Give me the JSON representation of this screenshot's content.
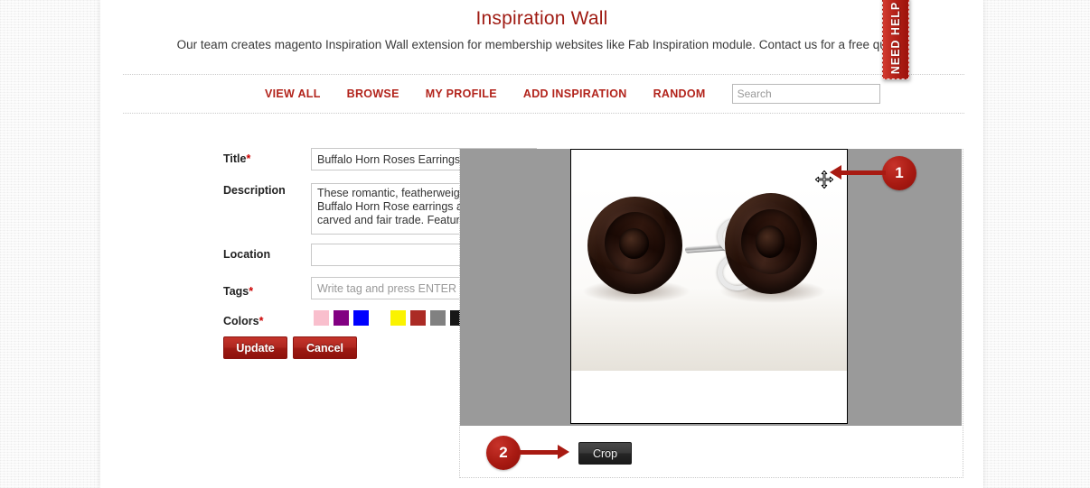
{
  "site": {
    "title": "Inspiration Wall",
    "tagline": "Our team creates magento Inspiration Wall extension for membership websites like Fab Inspiration module. Contact us for a free quote."
  },
  "nav": {
    "items": [
      {
        "label": "VIEW ALL"
      },
      {
        "label": "BROWSE"
      },
      {
        "label": "MY PROFILE"
      },
      {
        "label": "ADD INSPIRATION"
      },
      {
        "label": "RANDOM"
      }
    ],
    "search": {
      "value": "",
      "placeholder": "Search"
    }
  },
  "form": {
    "title": {
      "label": "Title",
      "required": "*",
      "value": "Buffalo Horn Roses Earrings",
      "placeholder": ""
    },
    "description": {
      "label": "Description",
      "required": "",
      "value": "These romantic, featherweight Black Buffalo Horn Rose earrings are hand-carved and fair trade. Featuring",
      "placeholder": ""
    },
    "location": {
      "label": "Location",
      "required": "",
      "value": "",
      "placeholder": ""
    },
    "tags": {
      "label": "Tags",
      "required": "*",
      "value": "",
      "placeholder": "Write tag and press ENTER"
    },
    "colors": {
      "label": "Colors",
      "required": "*",
      "swatches": [
        {
          "name": "pink",
          "hex": "#f9bfcd"
        },
        {
          "name": "purple",
          "hex": "#820082"
        },
        {
          "name": "blue",
          "hex": "#0000ff"
        },
        {
          "name": "yellow",
          "hex": "#fbf300"
        },
        {
          "name": "brick-red",
          "hex": "#ab2b25"
        },
        {
          "name": "gray",
          "hex": "#818181"
        },
        {
          "name": "black",
          "hex": "#171717"
        },
        {
          "name": "green",
          "hex": "#0a7f0a"
        }
      ]
    },
    "buttons": {
      "update": "Update",
      "cancel": "Cancel"
    }
  },
  "cropper": {
    "crop_button": "Crop",
    "markers": [
      {
        "number": "1",
        "direction": "left"
      },
      {
        "number": "2",
        "direction": "right"
      }
    ],
    "cursor_icon": "move-cursor-icon",
    "photo_alt": "black buffalo horn carved rose stud earrings"
  },
  "help_tab": {
    "label": "NEED HELP"
  },
  "theme": {
    "brand_red": "#b2231b",
    "title_red": "#9f1a12",
    "marker_red": "#a81a12"
  }
}
